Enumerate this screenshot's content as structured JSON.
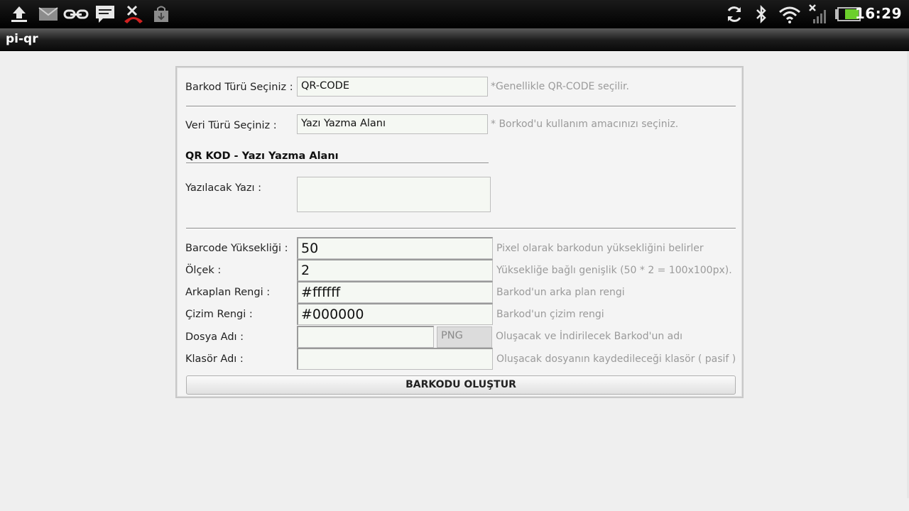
{
  "statusbar": {
    "time": "16:29",
    "icons_left": [
      "upload-icon",
      "mail-icon",
      "link-icon",
      "message-icon",
      "missed-call-icon",
      "shopping-bag-icon"
    ],
    "icons_right": [
      "sync-icon",
      "bluetooth-icon",
      "wifi-icon",
      "no-signal-icon",
      "battery-icon"
    ]
  },
  "app": {
    "title": "pi-qr"
  },
  "form": {
    "barcode_type": {
      "label": "Barkod Türü Seçiniz :",
      "value": "QR-CODE",
      "hint": "*Genellikle QR-CODE seçilir."
    },
    "data_type": {
      "label": "Veri Türü Seçiniz    :",
      "value": "Yazı Yazma Alanı",
      "hint": "* Borkod'u kullanım amacınızı seçiniz."
    },
    "section_title": "QR KOD - Yazı Yazma Alanı",
    "text_to_write": {
      "label": "Yazılacak Yazı :",
      "value": ""
    },
    "height": {
      "label": "Barcode Yüksekliği :",
      "value": "50",
      "hint": "Pixel olarak barkodun yüksekliğini belirler"
    },
    "scale": {
      "label": "Ölçek :",
      "value": "2",
      "hint": "Yüksekliğe bağlı genişlik (50 * 2 = 100x100px)."
    },
    "bg_color": {
      "label": "Arkaplan Rengi :",
      "value": "#ffffff",
      "hint": "Barkod'un arka plan rengi"
    },
    "draw_color": {
      "label": "Çizim Rengi :",
      "value": "#000000",
      "hint": "Barkod'un çizim rengi"
    },
    "file_name": {
      "label": "Dosya Adı :",
      "value": "",
      "ext": "PNG",
      "hint": "Oluşacak ve İndirilecek Barkod'un adı"
    },
    "folder_name": {
      "label": "Klasör Adı :",
      "value": "",
      "hint": "Oluşacak dosyanın kaydedileceği klasör ( pasif )"
    },
    "submit_label": "BARKODU OLUŞTUR"
  }
}
